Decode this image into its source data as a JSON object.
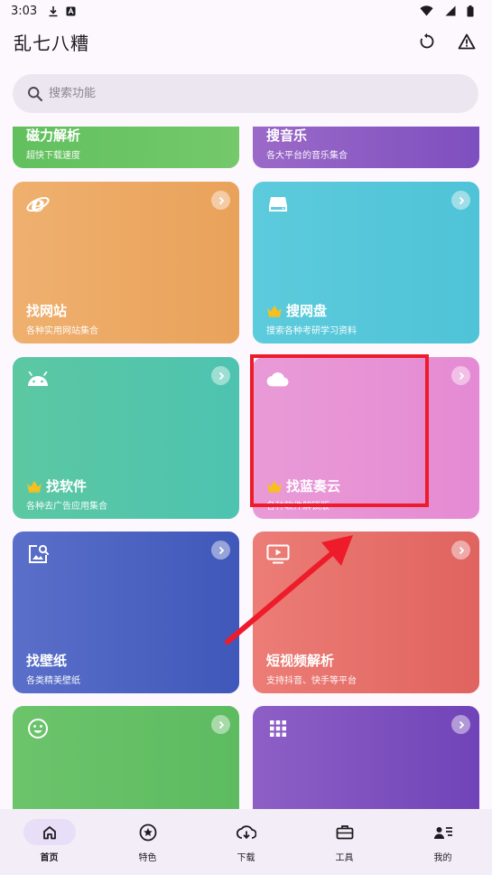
{
  "status_bar": {
    "time": "3:03"
  },
  "app_bar": {
    "title": "乱七八糟"
  },
  "search": {
    "placeholder": "搜索功能"
  },
  "cards": [
    {
      "title": "磁力解析",
      "subtitle": "超快下载速度",
      "icon": "magnet-icon",
      "crown": false,
      "color_from": "#62c05e",
      "color_to": "#74c96a"
    },
    {
      "title": "搜音乐",
      "subtitle": "各大平台的音乐集合",
      "icon": "music-icon",
      "crown": false,
      "color_from": "#9b6ac8",
      "color_to": "#7e4fbf"
    },
    {
      "title": "找网站",
      "subtitle": "各种实用网站集合",
      "icon": "ie-browser-icon",
      "crown": false,
      "color_from": "#efb06f",
      "color_to": "#e9a25a"
    },
    {
      "title": "搜网盘",
      "subtitle": "搜索各种考研学习资料",
      "icon": "hard-drive-icon",
      "crown": true,
      "color_from": "#5ccbdc",
      "color_to": "#4fc3d7"
    },
    {
      "title": "找软件",
      "subtitle": "各种去广告应用集合",
      "icon": "android-icon",
      "crown": true,
      "color_from": "#5cc8a2",
      "color_to": "#4dc3b0"
    },
    {
      "title": "找蓝奏云",
      "subtitle": "各种软件解锁版",
      "icon": "cloud-icon",
      "crown": true,
      "color_from": "#e99bd6",
      "color_to": "#e58ad4"
    },
    {
      "title": "找壁纸",
      "subtitle": "各类精美壁纸",
      "icon": "image-search-icon",
      "crown": false,
      "color_from": "#5a6fc9",
      "color_to": "#3f58b9"
    },
    {
      "title": "短视频解析",
      "subtitle": "支持抖音、快手等平台",
      "icon": "video-play-icon",
      "crown": false,
      "color_from": "#ec7d76",
      "color_to": "#e0635f"
    },
    {
      "title": "",
      "subtitle": "",
      "icon": "smiley-icon",
      "crown": false,
      "color_from": "#6cc46b",
      "color_to": "#5dbb60"
    },
    {
      "title": "",
      "subtitle": "",
      "icon": "apps-grid-icon",
      "crown": false,
      "color_from": "#8d5fc6",
      "color_to": "#7044b8"
    }
  ],
  "nav": [
    {
      "label": "首页",
      "icon": "home-icon",
      "active": true
    },
    {
      "label": "特色",
      "icon": "star-circle-icon",
      "active": false
    },
    {
      "label": "下载",
      "icon": "cloud-download-icon",
      "active": false
    },
    {
      "label": "工具",
      "icon": "toolbox-icon",
      "active": false
    },
    {
      "label": "我的",
      "icon": "person-list-icon",
      "active": false
    }
  ],
  "colors": {
    "background": "#fdf7fe",
    "search_bg": "#ece6f0",
    "nav_bg": "#f3edf7",
    "nav_active_pill": "#e8def8",
    "annotation": "#ee1c2b"
  }
}
